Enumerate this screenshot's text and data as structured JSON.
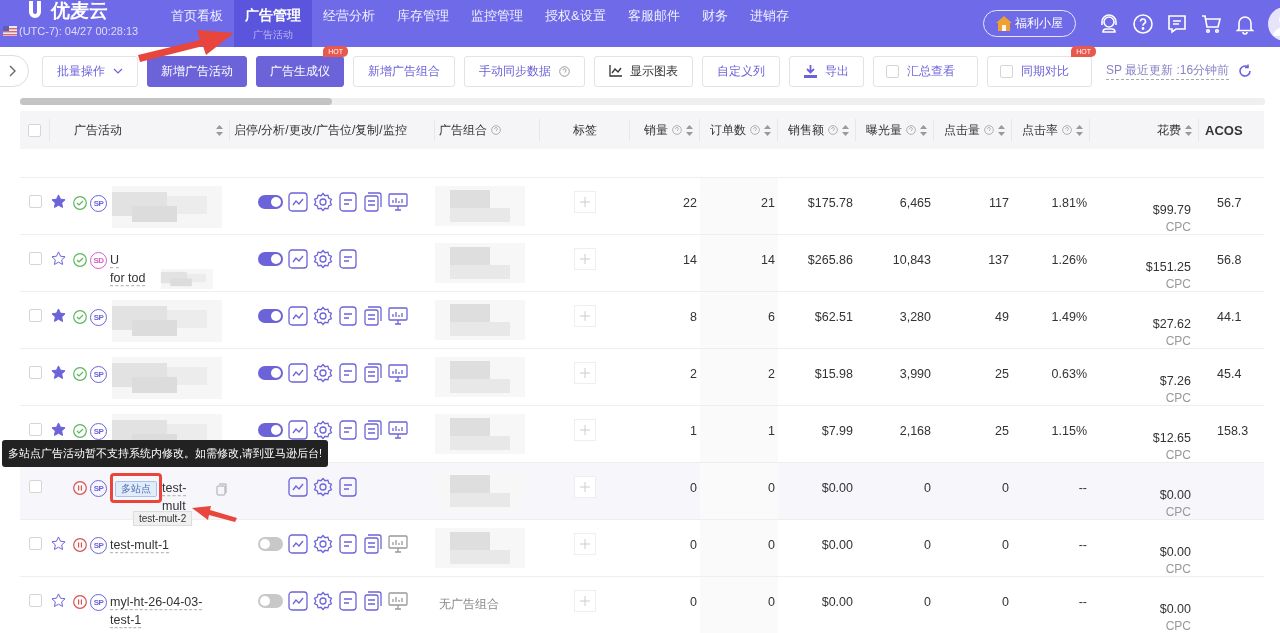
{
  "header": {
    "logo": "优麦云",
    "timezone": "(UTC-7): 04/27 00:28:13",
    "nav": [
      {
        "label": "首页看板",
        "selected": false
      },
      {
        "label": "广告管理",
        "selected": true,
        "sub": "广告活动"
      },
      {
        "label": "经营分析",
        "selected": false
      },
      {
        "label": "库存管理",
        "selected": false
      },
      {
        "label": "监控管理",
        "selected": false
      },
      {
        "label": "授权&设置",
        "selected": false
      },
      {
        "label": "客服邮件",
        "selected": false
      },
      {
        "label": "财务",
        "selected": false
      },
      {
        "label": "进销存",
        "selected": false
      }
    ],
    "welfare": "福利小屋"
  },
  "toolbar": {
    "items": [
      {
        "label": "批量操作",
        "kind": "dropdown"
      },
      {
        "label": "新增广告活动",
        "kind": "primary"
      },
      {
        "label": "广告生成仪",
        "kind": "primary",
        "badge": "HOT"
      },
      {
        "label": "新增广告组合",
        "kind": "plain"
      },
      {
        "label": "手动同步数据",
        "kind": "help"
      },
      {
        "label": "显示图表",
        "kind": "chart"
      },
      {
        "label": "自定义列",
        "kind": "plain"
      },
      {
        "label": "导出",
        "kind": "export"
      },
      {
        "label": "汇总查看",
        "kind": "checkbox",
        "checked": false
      },
      {
        "label": "同期对比",
        "kind": "checkbox",
        "checked": false,
        "badge": "HOT"
      }
    ],
    "sync": "SP 最近更新 :16分钟前"
  },
  "table": {
    "select_all_checked": false,
    "columns": [
      {
        "label": "广告活动",
        "help": false,
        "sort": true
      },
      {
        "label": "启停/分析/更改/广告位/复制/监控",
        "help": false,
        "sort": false
      },
      {
        "label": "广告组合",
        "help": true,
        "sort": false
      },
      {
        "label": "标签",
        "help": false,
        "sort": false
      },
      {
        "label": "销量",
        "help": true,
        "sort": true
      },
      {
        "label": "订单数",
        "help": true,
        "sort": true
      },
      {
        "label": "销售额",
        "help": true,
        "sort": true
      },
      {
        "label": "曝光量",
        "help": true,
        "sort": true
      },
      {
        "label": "点击量",
        "help": true,
        "sort": true
      },
      {
        "label": "点击率",
        "help": true,
        "sort": true
      },
      {
        "label": "花费",
        "help": false,
        "sort": true
      },
      {
        "label": "ACOS",
        "help": false,
        "sort": false
      }
    ],
    "rows": [
      {
        "checked": false,
        "favorite": true,
        "enabled": true,
        "ad_type": "SP",
        "name_blurred": true,
        "on": true,
        "copy": true,
        "monitor": true,
        "monitor_active": true,
        "group_blurred": true,
        "metrics": [
          "22",
          "21",
          "$175.78",
          "6,465",
          "117",
          "1.81%",
          "$99.79"
        ],
        "cpc": "CPC",
        "acos": "56.7"
      },
      {
        "checked": false,
        "favorite": false,
        "enabled": true,
        "ad_type": "SD",
        "name": "U\nfor tod",
        "name_blurred": true,
        "on": true,
        "copy": false,
        "monitor": false,
        "group_blurred": true,
        "metrics": [
          "14",
          "14",
          "$265.86",
          "10,843",
          "137",
          "1.26%",
          "$151.25"
        ],
        "cpc": "CPC",
        "acos": "56.8"
      },
      {
        "checked": false,
        "favorite": true,
        "enabled": true,
        "ad_type": "SP",
        "name_blurred": true,
        "on": true,
        "copy": true,
        "monitor": true,
        "monitor_active": true,
        "group_blurred": true,
        "metrics": [
          "8",
          "6",
          "$62.51",
          "3,280",
          "49",
          "1.49%",
          "$27.62"
        ],
        "cpc": "CPC",
        "acos": "44.1"
      },
      {
        "checked": false,
        "favorite": true,
        "enabled": true,
        "ad_type": "SP",
        "name_blurred": true,
        "on": true,
        "copy": true,
        "monitor": true,
        "monitor_active": true,
        "group_blurred": true,
        "metrics": [
          "2",
          "2",
          "$15.98",
          "3,990",
          "25",
          "0.63%",
          "$7.26"
        ],
        "cpc": "CPC",
        "acos": "45.4"
      },
      {
        "checked": false,
        "favorite": true,
        "enabled": true,
        "ad_type": "SP",
        "name_blurred": true,
        "on": true,
        "copy": true,
        "monitor": true,
        "monitor_active": true,
        "group_blurred": true,
        "metrics": [
          "1",
          "1",
          "$7.99",
          "2,168",
          "25",
          "1.15%",
          "$12.65"
        ],
        "cpc": "CPC",
        "acos": "158.3"
      },
      {
        "checked": false,
        "enabled": false,
        "ad_type": "SP",
        "multi_site": "多站点",
        "name": "test-\nmult",
        "copy": true,
        "monitor": false,
        "hovered": true,
        "group_blurred": true,
        "metrics": [
          "0",
          "0",
          "$0.00",
          "0",
          "0",
          "--",
          "$0.00"
        ],
        "cpc": "CPC",
        "tooltip": "test-mult-2"
      },
      {
        "checked": false,
        "favorite": false,
        "enabled": false,
        "ad_type": "SP",
        "name": "test-mult-1",
        "on": false,
        "copy": true,
        "monitor": true,
        "monitor_active": false,
        "group_blurred": true,
        "metrics": [
          "0",
          "0",
          "$0.00",
          "0",
          "0",
          "--",
          "$0.00"
        ],
        "cpc": "CPC"
      },
      {
        "checked": false,
        "favorite": false,
        "enabled": false,
        "ad_type": "SP",
        "name": "myl-ht-26-04-03-\ntest-1",
        "on": false,
        "copy": true,
        "monitor": true,
        "monitor_active": false,
        "group": "无广告组合",
        "metrics": [
          "0",
          "0",
          "$0.00",
          "0",
          "0",
          "--",
          "$0.00"
        ],
        "cpc": "CPC"
      }
    ]
  },
  "popover": "多站点广告活动暂不支持系统内修改。如需修改,请到亚马逊后台!"
}
